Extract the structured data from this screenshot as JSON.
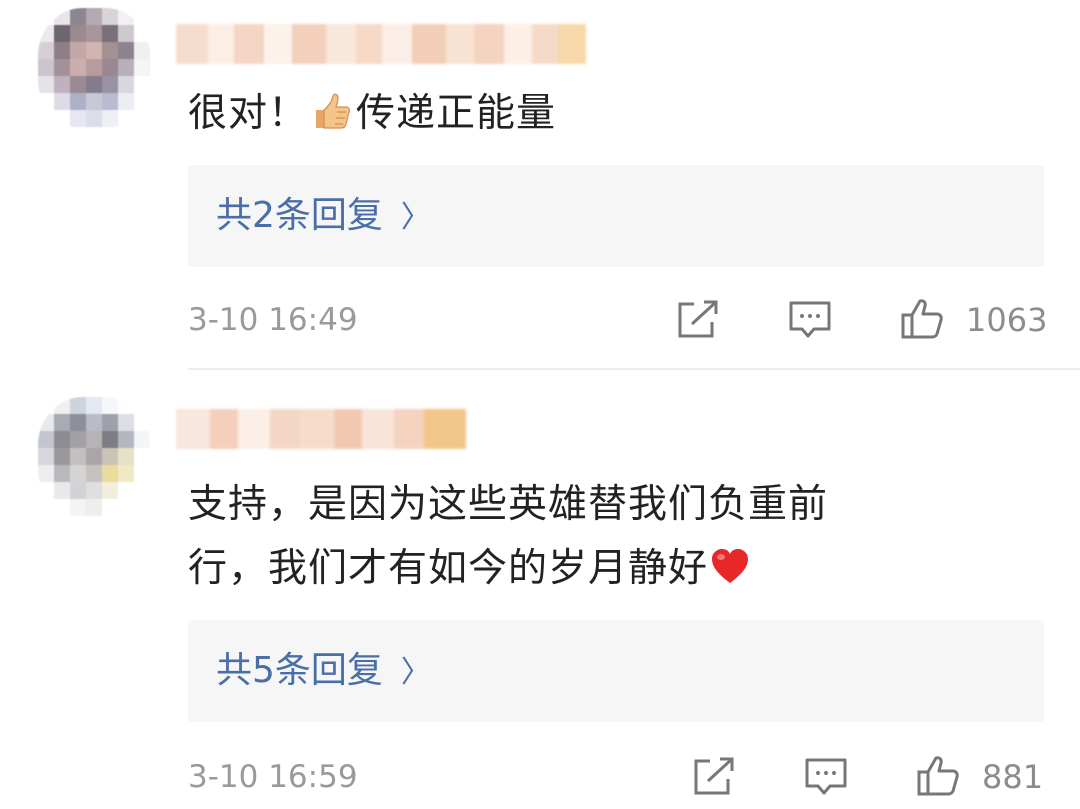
{
  "comments": [
    {
      "text_before_emoji": "很对！",
      "emoji": "thumbs-up-emoji",
      "text_after_emoji": "传递正能量",
      "reply_label": "共2条回复",
      "time": "3-10 16:49",
      "likes": "1063"
    },
    {
      "lines": [
        "支持，是因为这些英雄替我们负重前",
        "行，我们才有如今的岁月静好"
      ],
      "emoji": "red-heart-emoji",
      "reply_label": "共5条回复",
      "time": "3-10 16:59",
      "likes": "881"
    }
  ],
  "icons": {
    "share": "share-icon",
    "comment": "comment-icon",
    "like": "like-icon",
    "reply_chevron": "chevron-right-icon"
  },
  "colors": {
    "link": "#4a6fa8",
    "meta": "#9a9a9a",
    "reply_bg": "#f6f6f6",
    "heart": "#e8272b"
  }
}
